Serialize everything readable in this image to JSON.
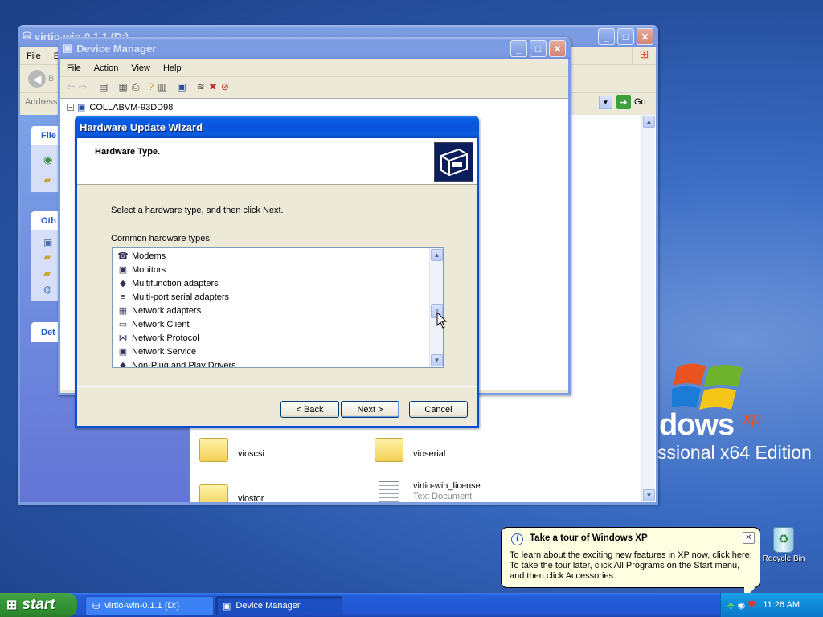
{
  "desktop": {
    "brand_line1": "dows",
    "brand_xp": "xp",
    "brand_line2": "ssional x64 Edition",
    "recycle_bin": "Recycle Bin"
  },
  "explorer": {
    "title": "virtio-win-0.1.1 (D:)",
    "menu": [
      "File",
      "E"
    ],
    "back": "B",
    "address_label": "Address",
    "go_label": "Go",
    "panel_file": "File",
    "panel_other": "Oth",
    "panel_details": "Det",
    "files": [
      {
        "name": "vioscsi",
        "type": ""
      },
      {
        "name": "vioserial",
        "type": ""
      },
      {
        "name": "viostor",
        "type": ""
      },
      {
        "name": "virtio-win_license",
        "type": "Text Document"
      }
    ]
  },
  "device_manager": {
    "title": "Device Manager",
    "menu": [
      "File",
      "Action",
      "View",
      "Help"
    ],
    "tree_root": "COLLABVM-93DD98"
  },
  "wizard": {
    "title": "Hardware Update Wizard",
    "header": "Hardware Type.",
    "instruction": "Select a hardware type, and then click Next.",
    "list_label": "Common hardware types:",
    "items": [
      {
        "label": "Modems",
        "icon": "modem-icon"
      },
      {
        "label": "Monitors",
        "icon": "monitor-icon"
      },
      {
        "label": "Multifunction adapters",
        "icon": "multifunction-icon"
      },
      {
        "label": "Multi-port serial adapters",
        "icon": "serial-port-icon"
      },
      {
        "label": "Network adapters",
        "icon": "network-card-icon"
      },
      {
        "label": "Network Client",
        "icon": "network-client-icon"
      },
      {
        "label": "Network Protocol",
        "icon": "protocol-icon"
      },
      {
        "label": "Network Service",
        "icon": "network-service-icon"
      },
      {
        "label": "Non-Plug and Play Drivers",
        "icon": "driver-icon"
      }
    ],
    "back": "< Back",
    "next": "Next >",
    "cancel": "Cancel"
  },
  "balloon": {
    "title": "Take a tour of Windows XP",
    "body_1": "To learn about the exciting new features in XP now, click here.",
    "body_2": "To take the tour later, click All Programs on the Start menu,",
    "body_3": "and then click Accessories."
  },
  "taskbar": {
    "start": "start",
    "tasks": [
      "virtio-win-0.1.1 (D:)",
      "Device Manager"
    ],
    "clock": "11:26 AM"
  }
}
